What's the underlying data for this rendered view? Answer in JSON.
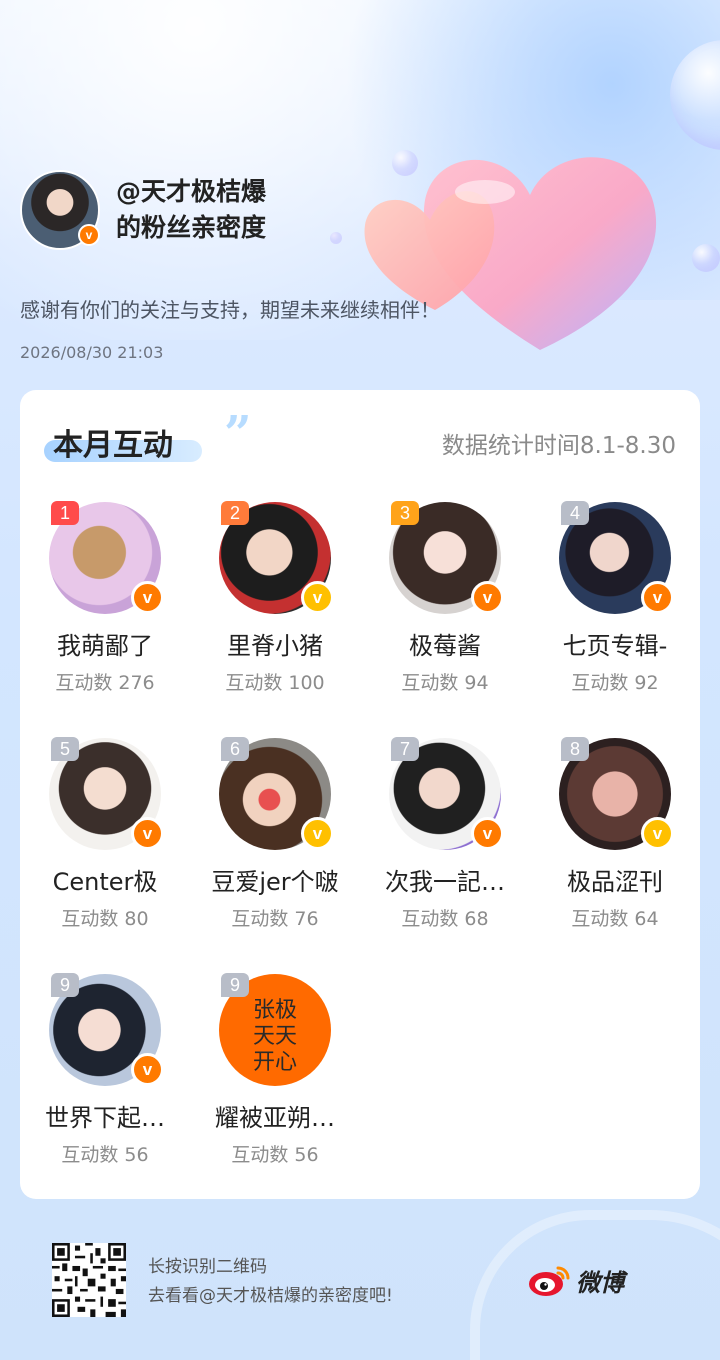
{
  "header": {
    "title_line1": "@天才极桔爆",
    "title_line2": "的粉丝亲密度",
    "message": "感谢有你们的关注与支持，期望未来继续相伴！",
    "timestamp": "2026/08/30  21:03"
  },
  "card": {
    "title": "本月互动",
    "stats_period": "数据统计时间8.1-8.30"
  },
  "fans": [
    {
      "rank": "1",
      "name": "我萌鄙了",
      "count": "互动数 276",
      "badge": "orange"
    },
    {
      "rank": "2",
      "name": "里脊小猪",
      "count": "互动数 100",
      "badge": "yellow"
    },
    {
      "rank": "3",
      "name": "极莓酱",
      "count": "互动数 94",
      "badge": "orange"
    },
    {
      "rank": "4",
      "name": "七页专辑-",
      "count": "互动数 92",
      "badge": "orange"
    },
    {
      "rank": "5",
      "name": "Center极",
      "count": "互动数 80",
      "badge": "orange"
    },
    {
      "rank": "6",
      "name": "豆爱jer个啵",
      "count": "互动数 76",
      "badge": "yellow"
    },
    {
      "rank": "7",
      "name": "次我一記…",
      "count": "互动数 68",
      "badge": "orange"
    },
    {
      "rank": "8",
      "name": "极品涩刊",
      "count": "互动数 64",
      "badge": "yellow"
    },
    {
      "rank": "9",
      "name": "世界下起…",
      "count": "互动数 56",
      "badge": "orange"
    },
    {
      "rank": "9",
      "name": "耀被亚朔…",
      "count": "互动数 56",
      "badge": "none"
    }
  ],
  "avatar_10_text": [
    "张极",
    "天天",
    "开心"
  ],
  "badge_letter": "v",
  "footer": {
    "line1": "长按识别二维码",
    "line2": "去看看@天才极桔爆的亲密度吧!",
    "brand": "微博"
  },
  "colors": {
    "badge_orange": "#ff7a00",
    "badge_yellow": "#ffc000",
    "rank1": "#ff4b4b",
    "rank2": "#ff7b3a",
    "rank3": "#ffa31a",
    "rank_other": "#b8bdc8",
    "weibo_red": "#e6162d"
  },
  "icons": [
    "v-verified-badge-icon",
    "qr-code-icon",
    "weibo-logo-icon",
    "heart-decoration-icon"
  ]
}
